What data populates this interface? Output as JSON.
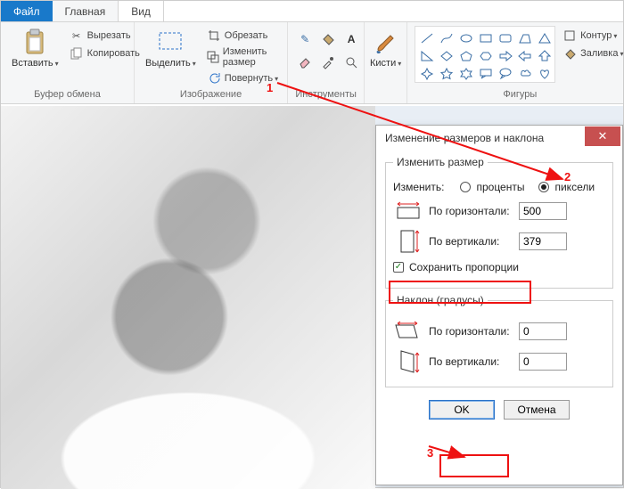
{
  "tabs": {
    "file": "Файл",
    "home": "Главная",
    "view": "Вид"
  },
  "ribbon": {
    "clipboard": {
      "label": "Буфер обмена",
      "paste": "Вставить",
      "cut": "Вырезать",
      "copy": "Копировать"
    },
    "image": {
      "label": "Изображение",
      "select": "Выделить",
      "crop": "Обрезать",
      "resize": "Изменить размер",
      "rotate": "Повернуть"
    },
    "tools": {
      "label": "Инструменты"
    },
    "brushes": {
      "label": "Кисти"
    },
    "shapes": {
      "label": "Фигуры",
      "outline": "Контур",
      "fill": "Заливка"
    }
  },
  "dialog": {
    "title": "Изменение размеров и наклона",
    "resize_legend": "Изменить размер",
    "by_label": "Изменить:",
    "percent": "проценты",
    "pixels": "пиксели",
    "horizontal": "По горизонтали:",
    "vertical": "По вертикали:",
    "h_value": "500",
    "v_value": "379",
    "keep_ratio": "Сохранить пропорции",
    "skew_legend": "Наклон (градусы)",
    "skew_h_value": "0",
    "skew_v_value": "0",
    "ok": "OK",
    "cancel": "Отмена"
  },
  "annotations": {
    "one": "1",
    "two": "2",
    "three": "3"
  }
}
